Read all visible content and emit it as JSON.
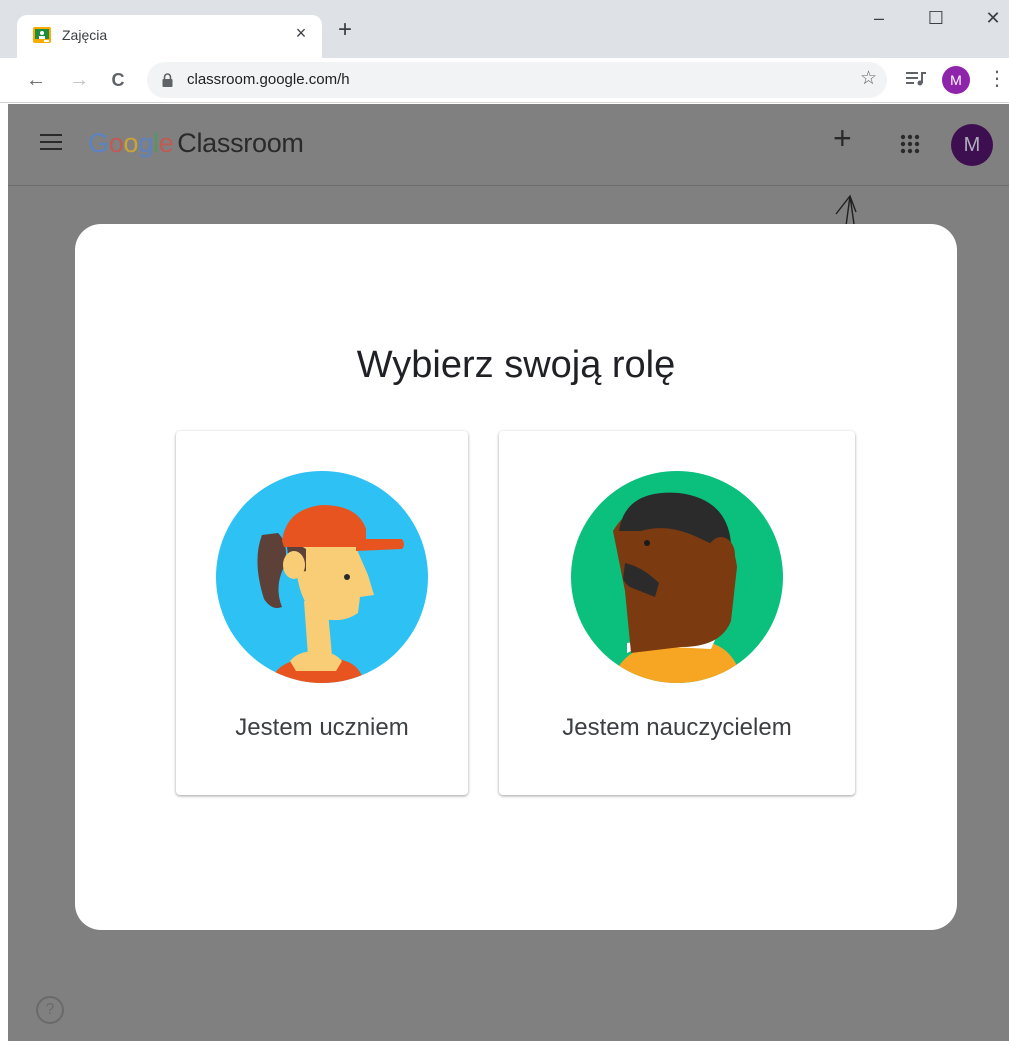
{
  "browser": {
    "tab_title": "Zajęcia",
    "tab_close": "×",
    "new_tab": "+",
    "window_controls": {
      "minimize": "–",
      "maximize": "☐",
      "close": "✕"
    },
    "back": "←",
    "forward": "→",
    "reload": "C",
    "url": "classroom.google.com/h",
    "star": "☆",
    "profile_initial": "M",
    "menu": "⋮"
  },
  "app": {
    "logo_google": [
      "G",
      "o",
      "o",
      "g",
      "l",
      "e"
    ],
    "logo_colors": [
      "#4285f4",
      "#ea4335",
      "#fbbc05",
      "#4285f4",
      "#34a853",
      "#ea4335"
    ],
    "product_name": "Classroom",
    "add": "+",
    "avatar_initial": "M",
    "help": "?"
  },
  "dialog": {
    "title": "Wybierz swoją rolę",
    "roles": [
      {
        "label": "Jestem uczniem"
      },
      {
        "label": "Jestem nauczycielem"
      }
    ]
  },
  "icons": {
    "favicon": "classroom-favicon",
    "lock": "lock-icon",
    "apps": "apps-grid-icon",
    "media": "media-control-icon"
  }
}
